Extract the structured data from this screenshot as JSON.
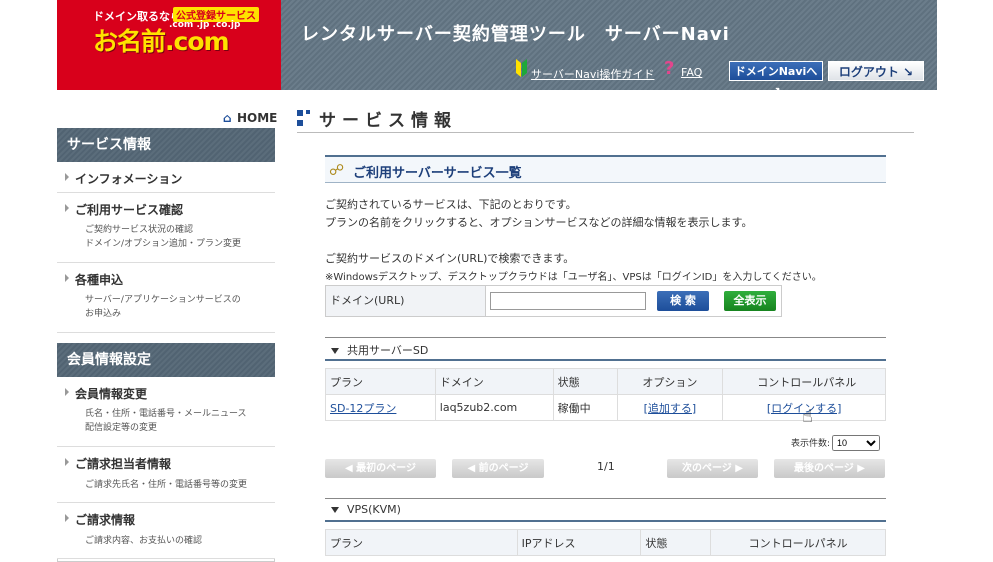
{
  "header": {
    "logo_line1": "ドメイン取るなら",
    "logo_badge": "公式登録サービス",
    "logo_tlds": ".com .jp .co.jp",
    "logo_brand": "お名前.com",
    "title": "レンタルサーバー契約管理ツール　サーバーNavi",
    "guide_link": "サーバーNavi操作ガイド",
    "faq_link": "FAQ",
    "domain_navi_button": "ドメインNaviへ ↗",
    "logout_button": "ログアウト ↘"
  },
  "sidebar": {
    "home": "HOME",
    "section1_title": "サービス情報",
    "section1_items": [
      {
        "label": "インフォメーション",
        "desc": ""
      },
      {
        "label": "ご利用サービス確認",
        "desc1": "ご契約サービス状況の確認",
        "desc2": "ドメイン/オプション追加・プラン変更"
      },
      {
        "label": "各種申込",
        "desc1": "サーバー/アプリケーションサービスの",
        "desc2": "お申込み"
      }
    ],
    "section2_title": "会員情報設定",
    "section2_items": [
      {
        "label": "会員情報変更",
        "desc1": "氏名・住所・電話番号・メールニュース",
        "desc2": "配信設定等の変更"
      },
      {
        "label": "ご請求担当者情報",
        "desc1": "ご請求先氏名・住所・電話番号等の変更",
        "desc2": ""
      },
      {
        "label": "ご請求情報",
        "desc1": "ご請求内容、お支払いの確認",
        "desc2": ""
      }
    ]
  },
  "main": {
    "title": "サービス情報",
    "sub_title": "ご利用サーバーサービス一覧",
    "intro1": "ご契約されているサービスは、下記のとおりです。",
    "intro2": "プランの名前をクリックすると、オプションサービスなどの詳細な情報を表示します。",
    "search_intro1": "ご契約サービスのドメイン(URL)で検索できます。",
    "search_intro2": "※Windowsデスクトップ、デスクトップクラウドは「ユーザ名」、VPSは「ログインID」を入力してください。",
    "search_label": "ドメイン(URL)",
    "search_value": "",
    "search_button": "検 索",
    "show_all_button": "全表示",
    "section_sd": "共用サーバーSD",
    "sd_columns": [
      "プラン",
      "ドメイン",
      "状態",
      "オプション",
      "コントロールパネル"
    ],
    "sd_row": {
      "plan": "SD-12プラン",
      "domain": "laq5zub2.com",
      "status": "稼働中",
      "option": "[追加する]",
      "panel": "[ログインする]"
    },
    "per_page_label": "表示件数:",
    "per_page_value": "10",
    "first_page": "◀ 最初のページ",
    "prev_page": "◀ 前のページ",
    "page_info": "1/1",
    "next_page": "次のページ ▶",
    "last_page": "最後のページ ▶",
    "section_vps": "VPS(KVM)",
    "vps_columns": [
      "プラン",
      "IPアドレス",
      "状態",
      "コントロールパネル"
    ]
  },
  "colors": {
    "brand_red": "#d8001b",
    "header_gray": "#6b7d8b",
    "link_blue": "#1d4e9a"
  }
}
